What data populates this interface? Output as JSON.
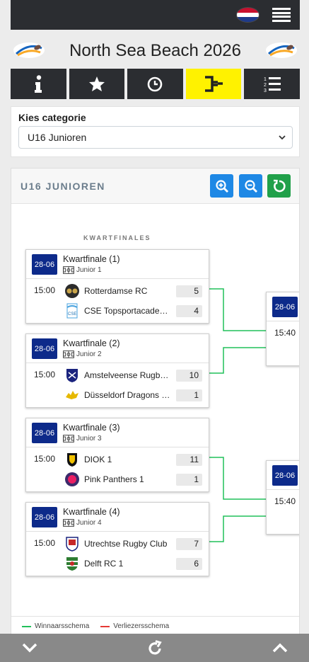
{
  "app": {
    "title": "North Sea Beach 2026"
  },
  "colors": {
    "primary_dark": "#2b2d31",
    "accent_yellow": "#fff200",
    "date_badge": "#0d2a8a",
    "winners_line": "#21c05a",
    "losers_line": "#e53935"
  },
  "nav": [
    {
      "icon": "info-icon"
    },
    {
      "icon": "star-icon"
    },
    {
      "icon": "clock-icon"
    },
    {
      "icon": "bracket-icon"
    },
    {
      "icon": "ranking-list-icon"
    }
  ],
  "category": {
    "label": "Kies categorie",
    "selected": "U16 Junioren"
  },
  "bracket": {
    "title": "U16 JUNIOREN",
    "round_title": "KWARTFINALES",
    "matches": [
      {
        "date": "28-06",
        "name": "Kwartfinale (1)",
        "field": "Junior 1",
        "time": "15:00",
        "home": {
          "name": "Rotterdamse RC",
          "score": "5"
        },
        "away": {
          "name": "CSE Topsportacademie",
          "score": "4"
        }
      },
      {
        "date": "28-06",
        "name": "Kwartfinale (2)",
        "field": "Junior 2",
        "time": "15:00",
        "home": {
          "name": "Amstelveense Rugby Club",
          "score": "10"
        },
        "away": {
          "name": "Düsseldorf Dragons RC",
          "score": "1"
        }
      },
      {
        "date": "28-06",
        "name": "Kwartfinale (3)",
        "field": "Junior 3",
        "time": "15:00",
        "home": {
          "name": "DIOK 1",
          "score": "11"
        },
        "away": {
          "name": "Pink Panthers 1",
          "score": "1"
        }
      },
      {
        "date": "28-06",
        "name": "Kwartfinale (4)",
        "field": "Junior 4",
        "time": "15:00",
        "home": {
          "name": "Utrechtse Rugby Club",
          "score": "7"
        },
        "away": {
          "name": "Delft RC 1",
          "score": "6"
        }
      }
    ],
    "next_matches": [
      {
        "date": "28-06",
        "time": "15:40"
      },
      {
        "date": "28-06",
        "time": "15:40"
      }
    ],
    "legend": {
      "winners": "Winnaarsschema",
      "losers": "Verliezersschema"
    }
  }
}
